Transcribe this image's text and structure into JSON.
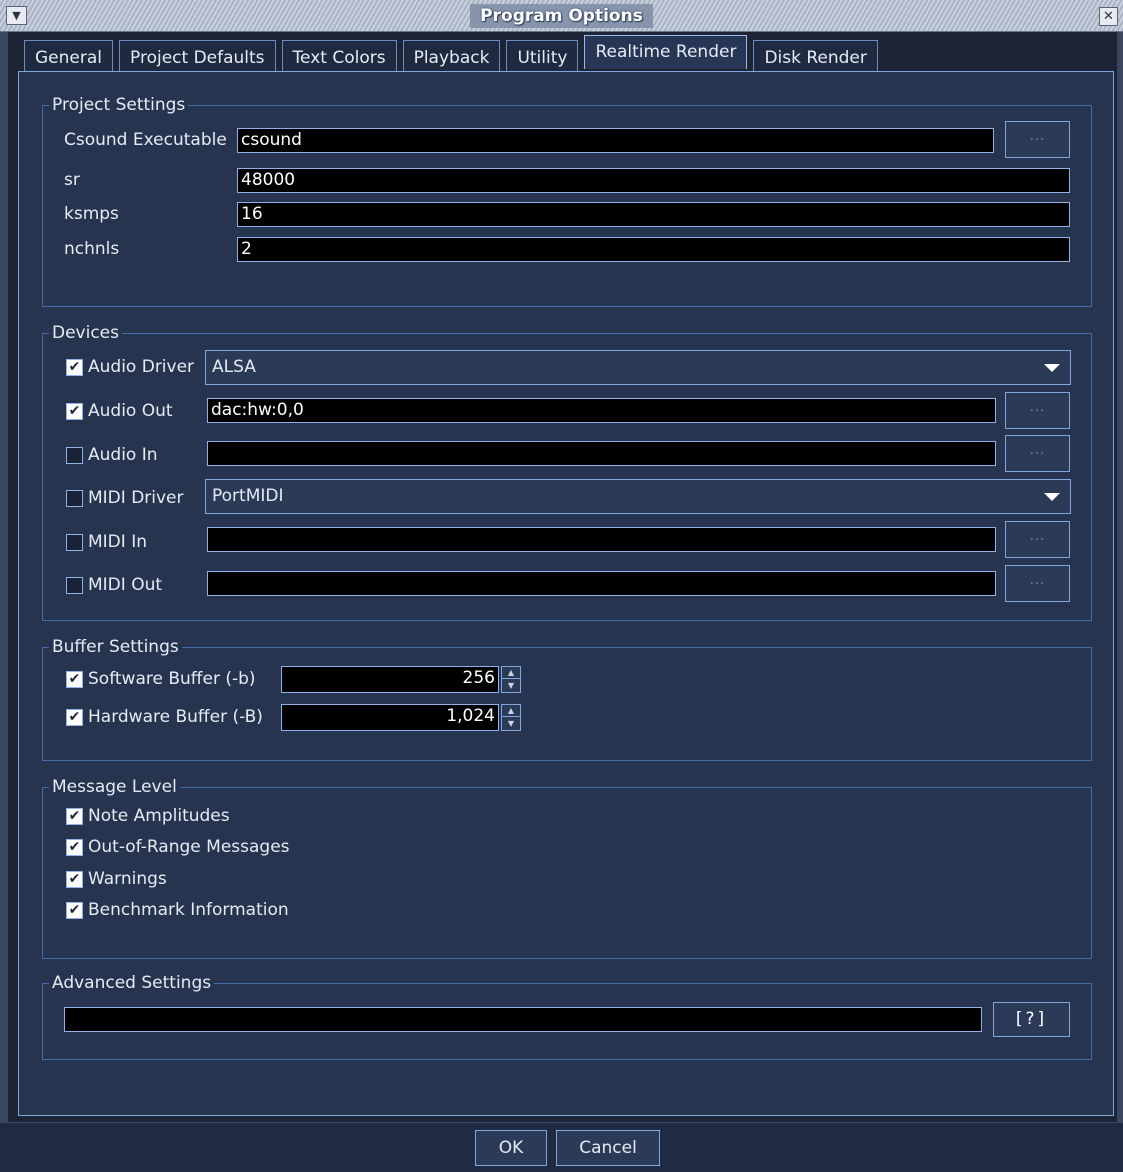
{
  "window": {
    "title": "Program Options",
    "menu_icon": "chevron-down-icon",
    "close_icon": "close-icon"
  },
  "tabs": [
    {
      "label": "General"
    },
    {
      "label": "Project Defaults"
    },
    {
      "label": "Text Colors"
    },
    {
      "label": "Playback"
    },
    {
      "label": "Utility"
    },
    {
      "label": "Realtime Render",
      "active": true
    },
    {
      "label": "Disk Render"
    }
  ],
  "project_settings": {
    "legend": "Project Settings",
    "csound_label": "Csound Executable",
    "csound_value": "csound",
    "browse_label": "...",
    "sr_label": "sr",
    "sr_value": "48000",
    "ksmps_label": "ksmps",
    "ksmps_value": "16",
    "nchnls_label": "nchnls",
    "nchnls_value": "2"
  },
  "devices": {
    "legend": "Devices",
    "audio_driver_label": "Audio Driver",
    "audio_driver_checked": true,
    "audio_driver_value": "ALSA",
    "audio_out_label": "Audio Out",
    "audio_out_checked": true,
    "audio_out_value": "dac:hw:0,0",
    "audio_in_label": "Audio In",
    "audio_in_checked": false,
    "audio_in_value": "",
    "midi_driver_label": "MIDI Driver",
    "midi_driver_checked": false,
    "midi_driver_value": "PortMIDI",
    "midi_in_label": "MIDI In",
    "midi_in_checked": false,
    "midi_in_value": "",
    "midi_out_label": "MIDI Out",
    "midi_out_checked": false,
    "midi_out_value": "",
    "browse_label": "..."
  },
  "buffer_settings": {
    "legend": "Buffer Settings",
    "software_label": "Software Buffer (-b)",
    "software_checked": true,
    "software_value": "256",
    "hardware_label": "Hardware Buffer (-B)",
    "hardware_checked": true,
    "hardware_value": "1,024"
  },
  "message_level": {
    "legend": "Message Level",
    "items": [
      {
        "label": "Note Amplitudes",
        "checked": true
      },
      {
        "label": "Out-of-Range Messages",
        "checked": true
      },
      {
        "label": "Warnings",
        "checked": true
      },
      {
        "label": "Benchmark Information",
        "checked": true
      }
    ]
  },
  "advanced_settings": {
    "legend": "Advanced Settings",
    "value": "",
    "help_label": "[?]"
  },
  "buttons": {
    "ok_label": "OK",
    "cancel_label": "Cancel"
  },
  "colors": {
    "background": "#26344f",
    "field": "#000000",
    "accent": "#7fa6dd"
  }
}
